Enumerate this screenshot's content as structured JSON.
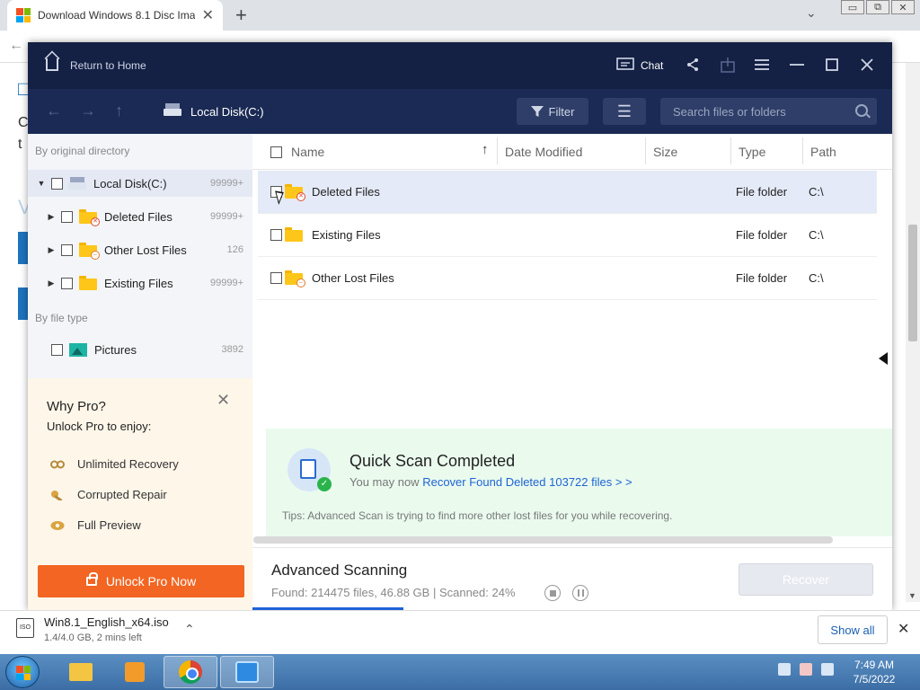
{
  "browser": {
    "tab_title": "Download Windows 8.1 Disc Ima",
    "tab_close": "✕",
    "new_tab": "+",
    "tab_search": "⌄",
    "window_controls": [
      "▭",
      "⧉",
      "✕"
    ],
    "back": "←"
  },
  "app": {
    "return_home": "Return to Home",
    "chat": "Chat",
    "titlebar_icons": [
      "chat-icon",
      "share-icon",
      "export-icon",
      "menu-icon",
      "minimize-icon",
      "maximize-icon",
      "close-icon"
    ],
    "nav": {
      "back": "←",
      "forward": "→",
      "up": "↑",
      "breadcrumb": "Local Disk(C:)",
      "filter_label": "Filter",
      "menu_glyph": "☰",
      "search_placeholder": "Search files or folders"
    },
    "sidebar": {
      "by_directory": "By original directory",
      "by_file_type": "By file type",
      "tree": [
        {
          "label": "Local Disk(C:)",
          "count": "99999+",
          "icon": "disk-icon"
        },
        {
          "label": "Deleted Files",
          "count": "99999+",
          "icon": "deleted-folder-icon"
        },
        {
          "label": "Other Lost Files",
          "count": "126",
          "icon": "lost-folder-icon"
        },
        {
          "label": "Existing Files",
          "count": "99999+",
          "icon": "folder-icon"
        }
      ],
      "file_types": [
        {
          "label": "Pictures",
          "count": "3892",
          "icon": "pictures-icon"
        }
      ]
    },
    "pro": {
      "title": "Why Pro?",
      "subtitle": "Unlock Pro to enjoy:",
      "features": [
        "Unlimited Recovery",
        "Corrupted Repair",
        "Full Preview"
      ],
      "unlock_label": "Unlock Pro Now",
      "close": "✕"
    },
    "list": {
      "columns": [
        "Name",
        "Date Modified",
        "Size",
        "Type",
        "Path"
      ],
      "sort_arrow": "↑",
      "rows": [
        {
          "name": "Deleted Files",
          "type": "File folder",
          "path": "C:\\",
          "badge": "✕"
        },
        {
          "name": "Existing Files",
          "type": "File folder",
          "path": "C:\\",
          "badge": ""
        },
        {
          "name": "Other Lost Files",
          "type": "File folder",
          "path": "C:\\",
          "badge": "–"
        }
      ]
    },
    "scan": {
      "title": "Quick Scan Completed",
      "prefix": "You may now",
      "link": "Recover Found Deleted 103722 files > >",
      "tip": "Tips: Advanced Scan is trying to find more other lost files for you while recovering."
    },
    "advanced": {
      "title": "Advanced Scanning",
      "stats": "Found: 214475 files, 46.88 GB  |  Scanned: 24%",
      "progress_percent": 24,
      "recover_label": "Recover"
    }
  },
  "download": {
    "icon_text": "ISO",
    "filename": "Win8.1_English_x64.iso",
    "status": "1.4/4.0 GB, 2 mins left",
    "chevron": "⌃",
    "show_all": "Show all",
    "close": "✕"
  },
  "taskbar": {
    "time": "7:49 AM",
    "date": "7/5/2022"
  },
  "colors": {
    "titlebar": "#142044",
    "navbar": "#1b2a54",
    "accent_orange": "#f26522",
    "link_blue": "#1e63d6",
    "scan_bg": "#eafbee"
  }
}
